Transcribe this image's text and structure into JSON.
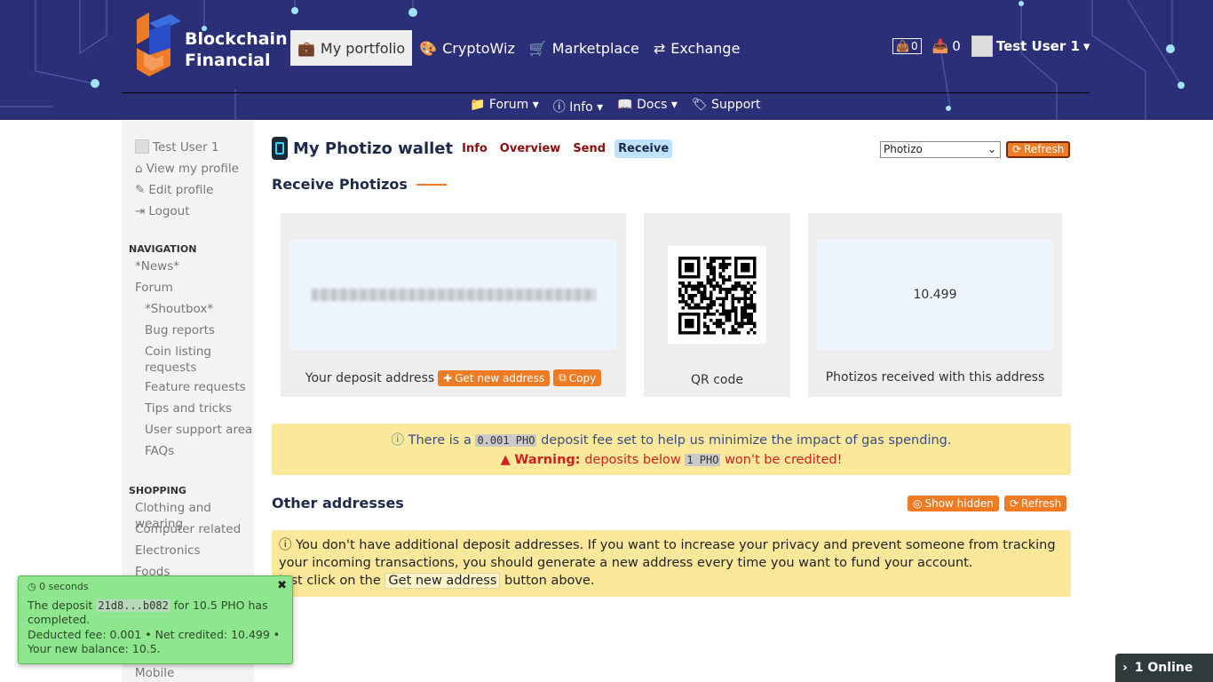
{
  "brand": {
    "line1": "Blockchain",
    "line2": "Financial"
  },
  "nav": [
    {
      "label": "My portfolio",
      "icon": "briefcase-icon"
    },
    {
      "label": "CryptoWiz",
      "icon": "palette-icon"
    },
    {
      "label": "Marketplace",
      "icon": "cart-icon"
    },
    {
      "label": "Exchange",
      "icon": "exchange-icon"
    }
  ],
  "topbar": {
    "cart_count": "0",
    "inbox_count": "0",
    "user": "Test User 1"
  },
  "subnav": [
    {
      "label": "Forum"
    },
    {
      "label": "Info"
    },
    {
      "label": "Docs"
    },
    {
      "label": "Support"
    }
  ],
  "sidebar": {
    "user": "Test User 1",
    "profile_links": [
      "View my profile",
      "Edit profile",
      "Logout"
    ],
    "nav_heading": "NAVIGATION",
    "nav_items": [
      "*News*",
      "Forum"
    ],
    "forum_items": [
      "*Shoutbox*",
      "Bug reports",
      "Coin listing requests",
      "Feature requests",
      "Tips and tricks",
      "User support area",
      "FAQs"
    ],
    "shop_heading": "SHOPPING",
    "shop_items": [
      "Clothing and wearing",
      "Computer related",
      "Electronics",
      "Foods"
    ],
    "bottom_item": "Mobile"
  },
  "wallet": {
    "title": "My Photizo wallet",
    "tabs": [
      "Info",
      "Overview",
      "Send",
      "Receive"
    ],
    "coin_select": "Photizo",
    "refresh": "Refresh",
    "section": "Receive Photizos",
    "deposit_label": "Your deposit address",
    "get_new": "Get new address",
    "copy": "Copy",
    "qr_label": "QR code",
    "received_value": "10.499",
    "received_label": "Photizos received with this address"
  },
  "notice": {
    "p1": "There is a",
    "fee": "0.001 PHO",
    "p2": "deposit fee set to help us minimize the impact of gas spending.",
    "warn_label": "Warning:",
    "w1": "deposits below",
    "min": "1 PHO",
    "w2": "won't be credited!"
  },
  "other": {
    "title": "Other addresses",
    "show_hidden": "Show hidden",
    "refresh": "Refresh",
    "info": "You don't have additional deposit addresses. If you want to increase your privacy and prevent someone from tracking your incoming transactions, you should generate a new address every time you want to fund your account.",
    "hint1": "Just click on the",
    "hint_btn": "Get new address",
    "hint2": "button above."
  },
  "toast": {
    "time": "0 seconds",
    "t1": "The deposit",
    "tx": "21d8...b082",
    "t2": "for 10.5 PHO has completed.",
    "t3": "Deducted fee: 0.001 • Net credited: 10.499 • Your new balance: 10.5."
  },
  "online": "1 Online",
  "colors": {
    "header": "#2a2f78",
    "accent": "#ef7b25",
    "notice": "#fbe89a",
    "toast": "#8ee68e"
  }
}
